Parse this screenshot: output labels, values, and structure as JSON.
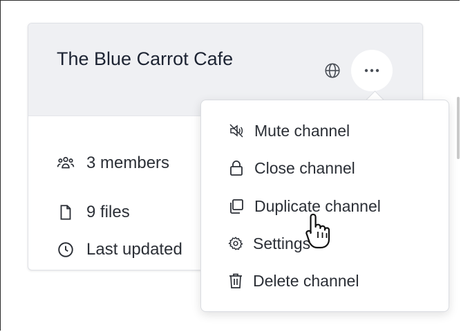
{
  "card": {
    "title": "The Blue Carrot Cafe",
    "globe_icon": "globe-icon",
    "more_icon": "ellipsis-icon",
    "members": "3 members",
    "files": "9 files",
    "last_updated": "Last updated"
  },
  "menu": {
    "items": [
      {
        "label": "Mute channel",
        "icon": "speaker-muted-icon"
      },
      {
        "label": "Close channel",
        "icon": "lock-icon"
      },
      {
        "label": "Duplicate channel",
        "icon": "copy-icon"
      },
      {
        "label": "Settings",
        "icon": "gear-icon"
      },
      {
        "label": "Delete channel",
        "icon": "trash-icon"
      }
    ]
  },
  "colors": {
    "header_bg": "#eff0f3",
    "text": "#2b2f36",
    "title": "#1d2433"
  }
}
